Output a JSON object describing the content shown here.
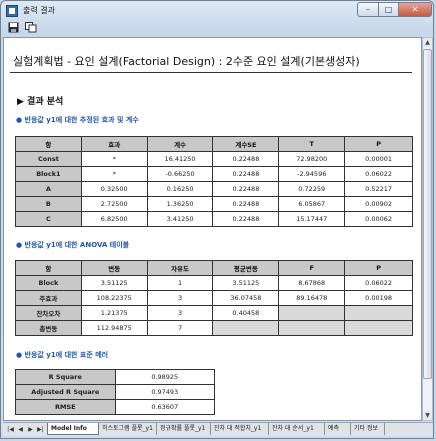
{
  "window": {
    "title": "출력 결과"
  },
  "report": {
    "title": "실험계획법 - 요인 설계(Factorial Design) : 2수준 요인 설계(기본생성자)",
    "result_heading": "▶ 결과 분석"
  },
  "section1": {
    "heading": "● 반응값 y1에 대한 추정된 효과 및 계수",
    "headers": [
      "항",
      "효과",
      "계수",
      "계수SE",
      "T",
      "P"
    ],
    "rows": [
      [
        "Const",
        "*",
        "16.41250",
        "0.22488",
        "72.98200",
        "0.00001"
      ],
      [
        "Block1",
        "*",
        "-0.66250",
        "0.22488",
        "-2.94596",
        "0.06022"
      ],
      [
        "A",
        "0.32500",
        "0.16250",
        "0.22488",
        "0.72259",
        "0.52217"
      ],
      [
        "B",
        "2.72500",
        "1.36250",
        "0.22488",
        "6.05867",
        "0.00902"
      ],
      [
        "C",
        "6.82500",
        "3.41250",
        "0.22488",
        "15.17447",
        "0.00062"
      ]
    ]
  },
  "section2": {
    "heading": "● 반응값 y1에 대한 ANOVA 테이블",
    "headers": [
      "항",
      "변동",
      "자유도",
      "평균변동",
      "F",
      "P"
    ],
    "rows": [
      [
        "Block",
        "3.51125",
        "1",
        "3.51125",
        "8.67868",
        "0.06022"
      ],
      [
        "주효과",
        "108.22375",
        "3",
        "36.07458",
        "89.16478",
        "0.00198"
      ],
      [
        "잔차오차",
        "1.21375",
        "3",
        "0.40458",
        "",
        ""
      ],
      [
        "총변동",
        "112.94875",
        "7",
        "",
        "",
        ""
      ]
    ]
  },
  "section3": {
    "heading": "● 반응값 y1에 대한 표준 메러",
    "rows": [
      [
        "R Square",
        "0.98925"
      ],
      [
        "Adjusted R Square",
        "0.97493"
      ],
      [
        "RMSE",
        "0.63607"
      ]
    ]
  },
  "tabs": [
    "Model Info",
    "히스토그램 플롯_y1",
    "정규확률 플롯_y1",
    "잔차 대 적합치_y1",
    "잔차 대 순서_y1",
    "예측",
    "기타 정보"
  ]
}
